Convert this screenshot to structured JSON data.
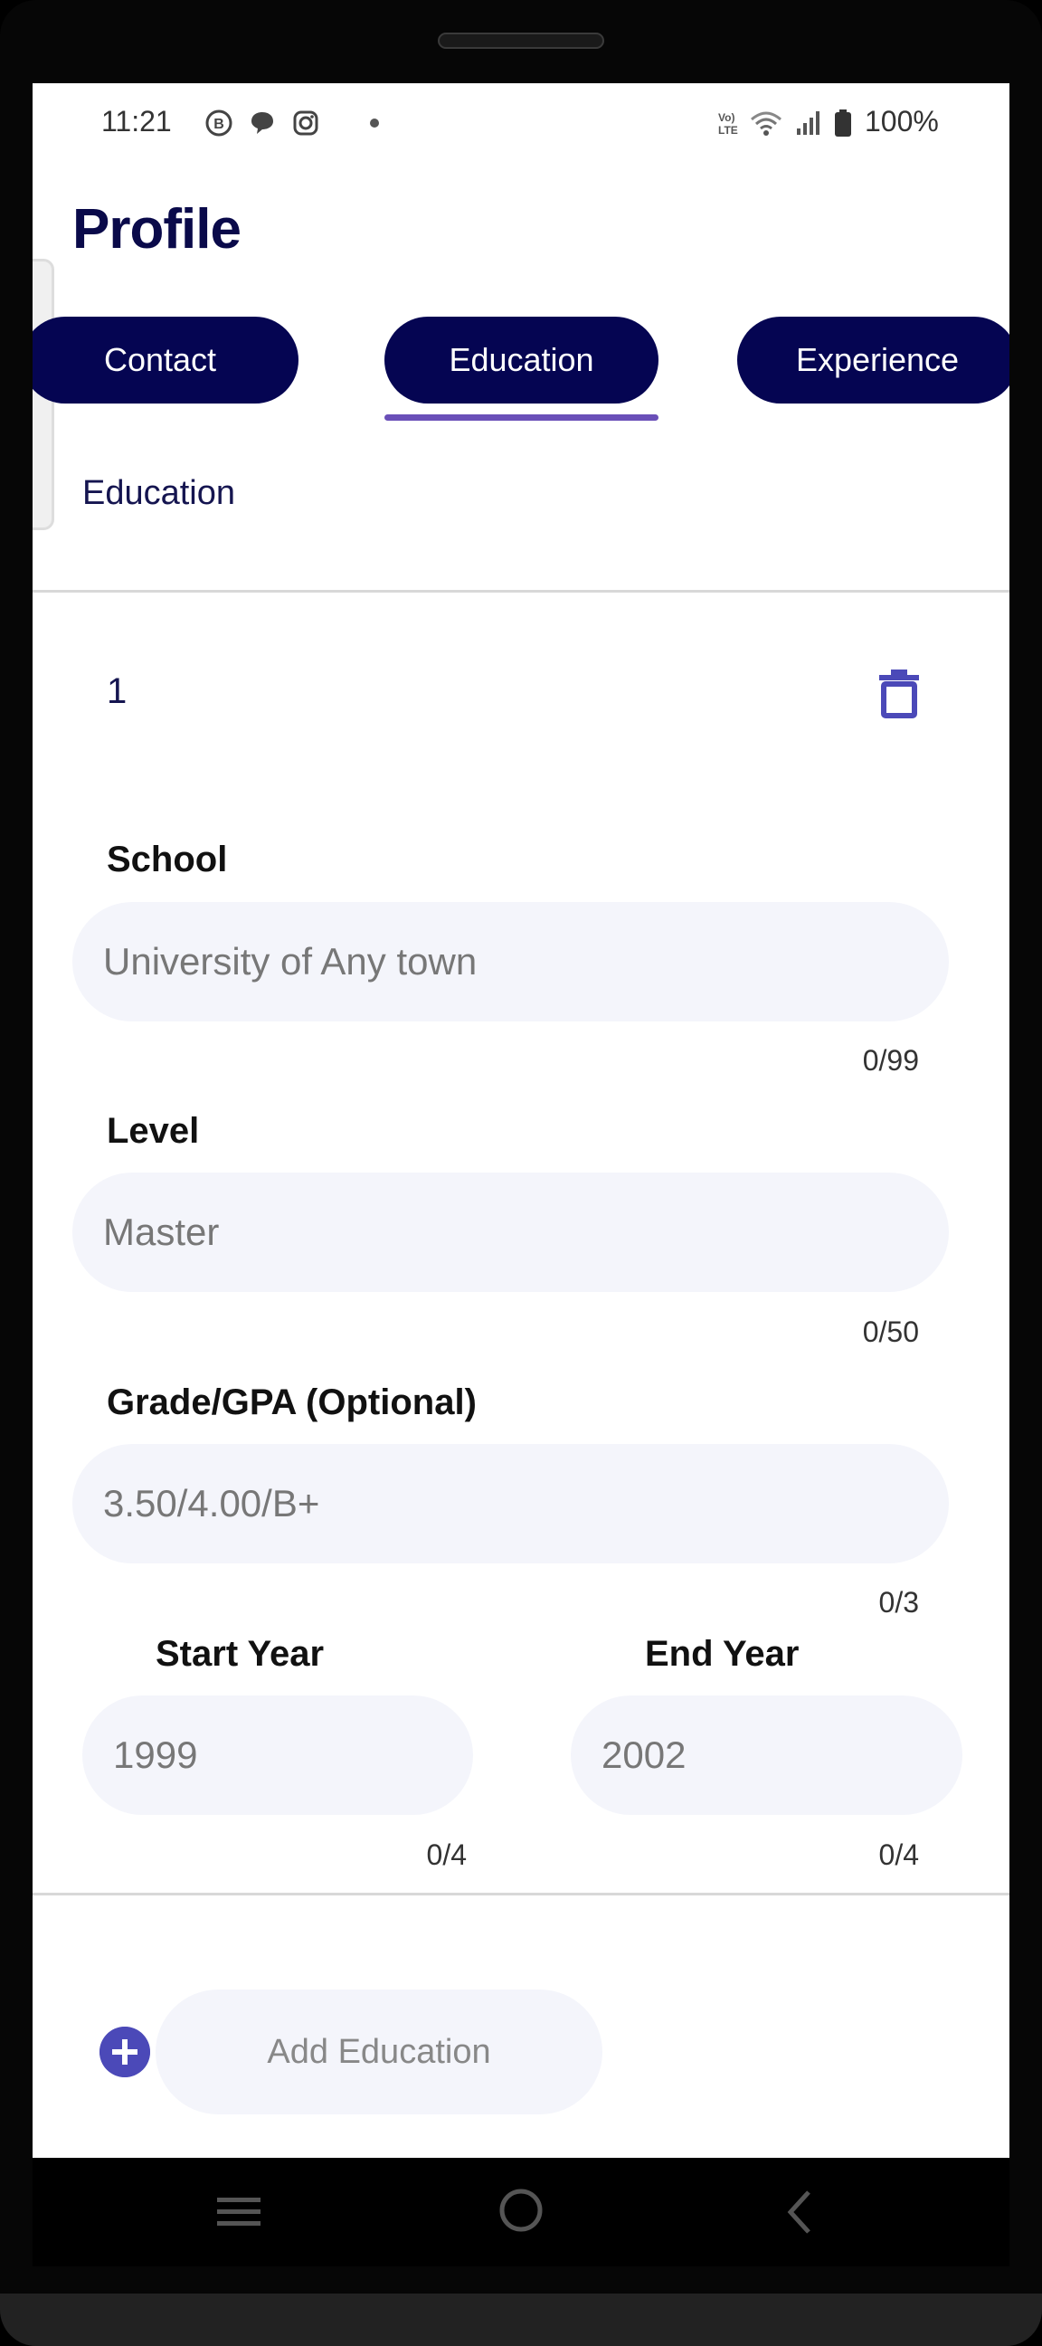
{
  "status_bar": {
    "time": "11:21",
    "notif_icons": [
      "b-circle-icon",
      "chat-bubble-icon",
      "instagram-icon",
      "dot-icon"
    ],
    "system_icons": [
      "volte-icon",
      "wifi-icon",
      "signal-icon",
      "battery-icon"
    ],
    "battery": "100%"
  },
  "header": {
    "title": "Profile"
  },
  "tabs": [
    {
      "label": "Contact"
    },
    {
      "label": "Education",
      "selected": true
    },
    {
      "label": "Experience"
    }
  ],
  "section": {
    "label": "Education"
  },
  "entry": {
    "number": "1",
    "delete_icon": "trash-icon",
    "school": {
      "label": "School",
      "placeholder": "University of Any town",
      "value": "",
      "counter": "0/99"
    },
    "level": {
      "label": "Level",
      "placeholder": "Master",
      "value": "",
      "counter": "0/50"
    },
    "grade": {
      "label": "Grade/GPA (Optional)",
      "placeholder": "3.50/4.00/B+",
      "value": "",
      "counter": "0/3"
    },
    "start_year": {
      "label": "Start Year",
      "placeholder": "1999",
      "value": "",
      "counter": "0/4"
    },
    "end_year": {
      "label": "End Year",
      "placeholder": "2002",
      "value": "",
      "counter": "0/4"
    }
  },
  "add_button": {
    "label": "Add Education",
    "icon": "plus-icon"
  },
  "nav_bar": {
    "icons": [
      "menu-icon",
      "home-icon",
      "back-icon"
    ]
  },
  "colors": {
    "primary": "#050552",
    "accent": "#4b49b8",
    "underline": "#6a4fb8",
    "field_bg": "#f4f5fb"
  }
}
